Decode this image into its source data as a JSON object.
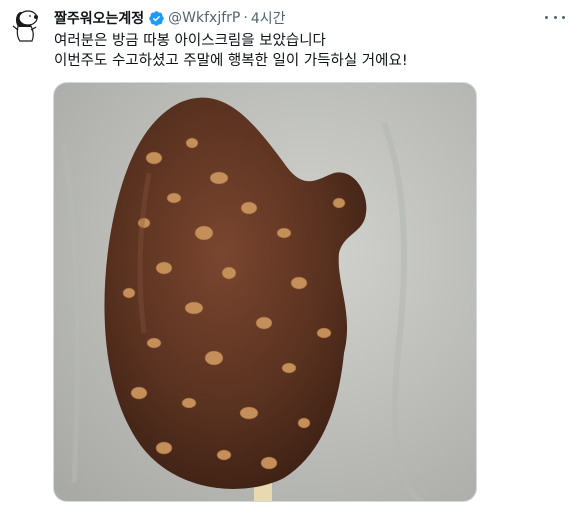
{
  "tweet": {
    "display_name": "짤주워오는계정",
    "handle": "@WkfxjfrP",
    "separator": "·",
    "timestamp": "4시간",
    "text_lines": [
      "여러분은 방금 따봉 아이스크림을 보았습니다",
      "이번주도 수고하셨고 주말에 행복한 일이 가득하실 거에요!"
    ]
  },
  "icons": {
    "avatar": "snoopy-avatar",
    "verified": "verified-badge-icon",
    "more": "more-options-icon"
  },
  "colors": {
    "verified_blue": "#1d9bf0",
    "secondary_text": "#536471",
    "chocolate": "#5a3220",
    "background_cloth": "#c9cac6"
  }
}
